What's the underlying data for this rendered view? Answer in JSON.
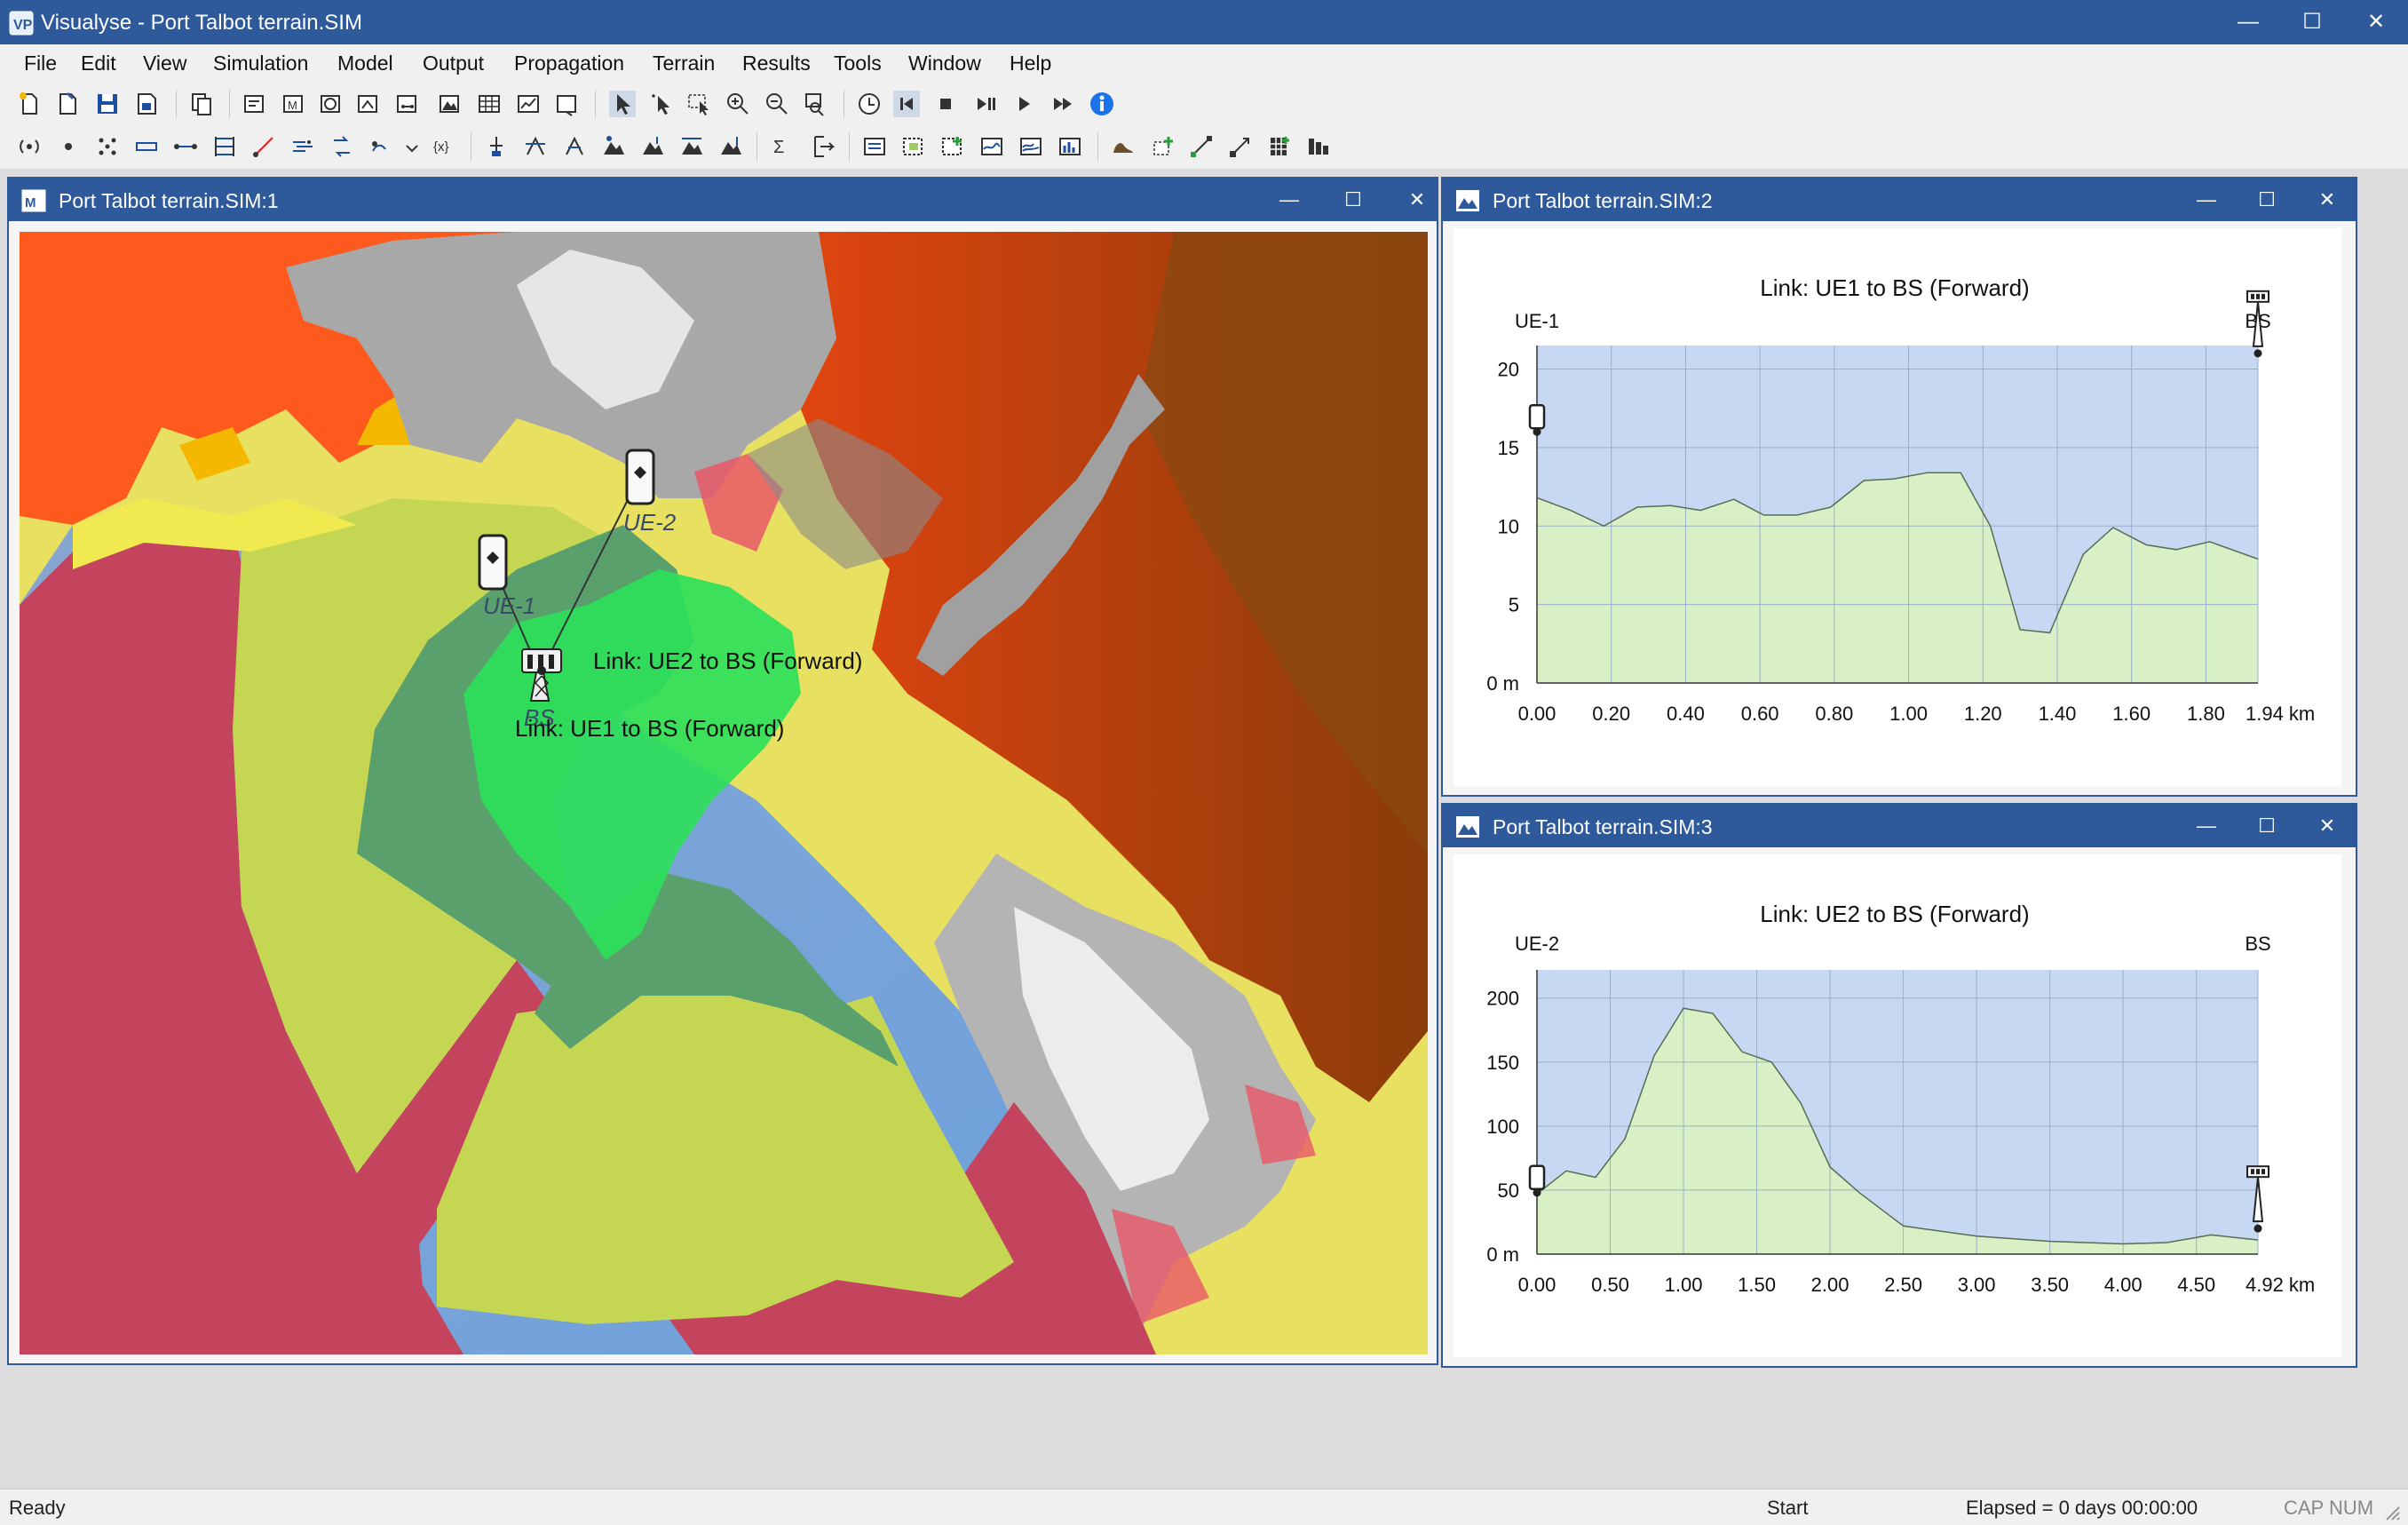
{
  "app": {
    "title": "Visualyse - Port Talbot terrain.SIM",
    "controls": {
      "minimize": "—",
      "maximize": "☐",
      "close": "✕"
    }
  },
  "menu": [
    "File",
    "Edit",
    "View",
    "Simulation",
    "Model",
    "Output",
    "Propagation",
    "Terrain",
    "Results",
    "Tools",
    "Window",
    "Help"
  ],
  "toolbar1_icons": [
    "new-icon",
    "open-icon",
    "save-icon",
    "save-as-icon",
    "copy-icon",
    "view-icon",
    "map-view-icon",
    "globe-view-icon",
    "network-view-icon",
    "link-view-icon",
    "terrain-view-icon",
    "table-view-icon",
    "graph-view-icon",
    "plot-view-icon",
    "select-icon",
    "select-point-icon",
    "select-area-icon",
    "zoom-in-icon",
    "zoom-out-icon",
    "zoom-extent-icon",
    "clock-icon",
    "skip-start-icon",
    "stop-icon",
    "step-icon",
    "play-icon",
    "fast-forward-icon",
    "info-icon"
  ],
  "toolbar2_icons": [
    "antenna-icon",
    "station-icon",
    "multi-station-icon",
    "carrier-icon",
    "link-icon",
    "link-group-icon",
    "interference-icon",
    "propagation-icon",
    "transmit-icon",
    "receive-icon",
    "variable-icon",
    "station-add-icon",
    "station-group-icon",
    "station-list-icon",
    "terrain-station-icon",
    "terrain-map-icon",
    "terrain-link-icon",
    "terrain-height-icon",
    "sum-icon",
    "export-icon",
    "area-analysis-icon",
    "area-select-icon",
    "area-add-icon",
    "area-plot-icon",
    "area-graph-icon",
    "area-chart-icon",
    "land-use-icon",
    "trace-icon",
    "point-to-point-icon",
    "move-icon",
    "grid-icon",
    "bar-chart-icon"
  ],
  "win1": {
    "title": "Port Talbot terrain.SIM:1",
    "labels": {
      "ue1": "UE-1",
      "ue2": "UE-2",
      "bs": "BS",
      "link1": "Link: UE1 to BS (Forward)",
      "link2": "Link: UE2 to BS (Forward)"
    }
  },
  "win2": {
    "title": "Port Talbot terrain.SIM:2"
  },
  "win3": {
    "title": "Port Talbot terrain.SIM:3"
  },
  "chart_data": [
    {
      "type": "area",
      "title": "Link: UE1 to BS (Forward)",
      "start_label": "UE-1",
      "end_label": "BS",
      "xlim": [
        0,
        1.94
      ],
      "ylim": [
        0,
        21.5
      ],
      "xticks": [
        "0.00",
        "0.20",
        "0.40",
        "0.60",
        "0.80",
        "1.00",
        "1.20",
        "1.40",
        "1.60",
        "1.80",
        "1.94 km"
      ],
      "xtick_values": [
        0,
        0.2,
        0.4,
        0.6,
        0.8,
        1.0,
        1.2,
        1.4,
        1.6,
        1.8,
        1.94
      ],
      "yticks": [
        "0 m",
        "5",
        "10",
        "15",
        "20"
      ],
      "ytick_values": [
        0,
        5,
        10,
        15,
        20
      ],
      "grid": true,
      "series": [
        {
          "x": [
            0,
            0.09,
            0.18,
            0.27,
            0.36,
            0.44,
            0.53,
            0.61,
            0.7,
            0.79,
            0.88,
            0.96,
            1.05,
            1.14,
            1.22,
            1.3,
            1.38,
            1.47,
            1.55,
            1.64,
            1.72,
            1.81,
            1.94
          ],
          "y": [
            11.8,
            11,
            10,
            11.2,
            11.3,
            11,
            11.7,
            10.7,
            10.7,
            11.2,
            12.9,
            13,
            13.4,
            13.4,
            10,
            3.4,
            3.2,
            8.2,
            9.9,
            8.8,
            8.5,
            9,
            7.9
          ]
        }
      ],
      "tx_height": 16,
      "rx_height": 21
    },
    {
      "type": "area",
      "title": "Link: UE2 to BS (Forward)",
      "start_label": "UE-2",
      "end_label": "BS",
      "xlim": [
        0,
        4.92
      ],
      "ylim": [
        0,
        222
      ],
      "xticks": [
        "0.00",
        "0.50",
        "1.00",
        "1.50",
        "2.00",
        "2.50",
        "3.00",
        "3.50",
        "4.00",
        "4.50",
        "4.92 km"
      ],
      "xtick_values": [
        0,
        0.5,
        1.0,
        1.5,
        2.0,
        2.5,
        3.0,
        3.5,
        4.0,
        4.5,
        4.92
      ],
      "yticks": [
        "0 m",
        "50",
        "100",
        "150",
        "200"
      ],
      "ytick_values": [
        0,
        50,
        100,
        150,
        200
      ],
      "grid": true,
      "series": [
        {
          "x": [
            0,
            0.2,
            0.4,
            0.6,
            0.8,
            1.0,
            1.2,
            1.4,
            1.6,
            1.8,
            2.0,
            2.2,
            2.5,
            3.0,
            3.5,
            4.0,
            4.3,
            4.6,
            4.92
          ],
          "y": [
            47,
            65,
            60,
            90,
            155,
            192,
            188,
            158,
            150,
            118,
            68,
            48,
            22,
            14,
            10,
            8,
            9,
            15,
            11
          ]
        }
      ],
      "tx_height": 48,
      "rx_height": 20
    }
  ],
  "status": {
    "left": "Ready",
    "start": "Start",
    "elapsed": "Elapsed = 0 days 00:00:00",
    "flags": "CAP NUM"
  }
}
